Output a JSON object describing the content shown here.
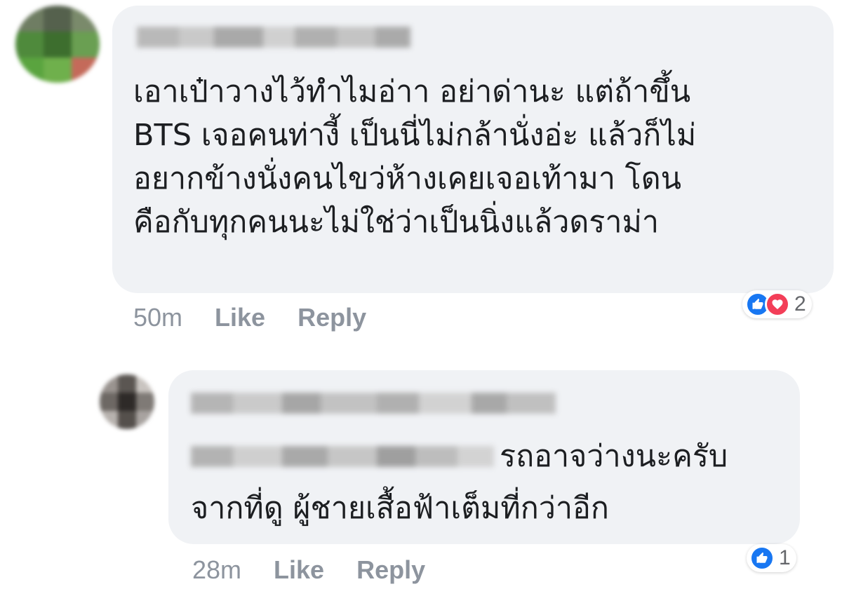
{
  "comments": [
    {
      "text": "เอาเป๋าวางไว้ทำไมอ่าา อย่าด่านะ แต่ถ้าขึ้น\nBTS เจอคนท่างี้ เป็นนี่ไม่กล้านั่งอ่ะ แล้วก็ไม่\nอยากข้างนั่งคนไขว่ห้างเคยเจอเท้ามา โดน\nคือกับทุกคนนะไม่ใช่ว่าเป็นนิ่งแล้วดราม่า",
      "time": "50m",
      "like_label": "Like",
      "reply_label": "Reply",
      "reaction_count": "2",
      "reactions": [
        "like-icon",
        "love-icon"
      ]
    },
    {
      "text_line1": "รถอาจว่างนะครับ",
      "text_line2": "จากที่ดู ผู้ชายเสื้อฟ้าเต็มที่กว่าอีก",
      "time": "28m",
      "like_label": "Like",
      "reply_label": "Reply",
      "reaction_count": "1",
      "reactions": [
        "like-icon"
      ]
    }
  ],
  "colors": {
    "bubble": "#f0f2f5",
    "like": "#1877f2",
    "love": "#f33e58",
    "meta": "#8d949e"
  }
}
